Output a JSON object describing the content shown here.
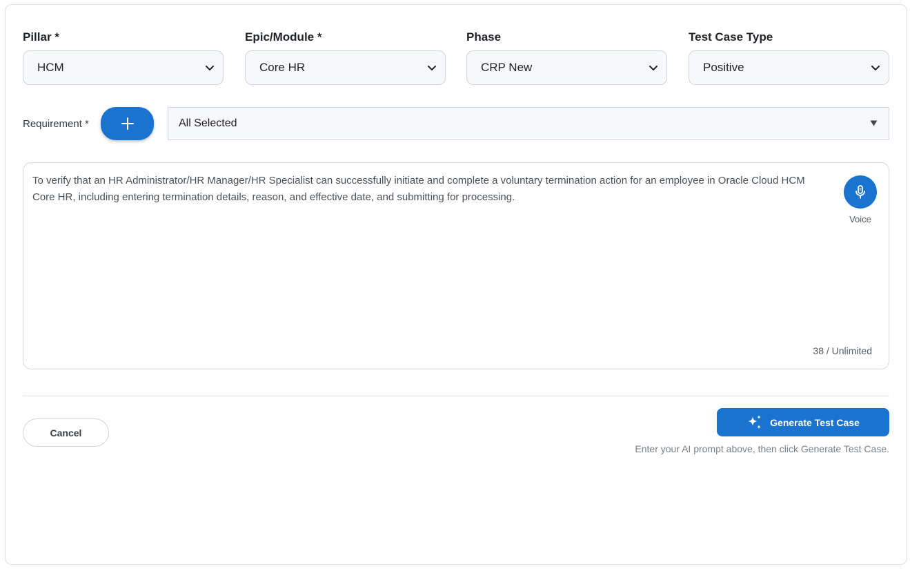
{
  "filters": {
    "pillar": {
      "label": "Pillar *",
      "value": "HCM"
    },
    "epic": {
      "label": "Epic/Module *",
      "value": "Core HR"
    },
    "phase": {
      "label": "Phase",
      "value": "CRP New"
    },
    "test_case_type": {
      "label": "Test Case Type",
      "value": "Positive"
    }
  },
  "requirement": {
    "label": "Requirement *",
    "value": "All Selected"
  },
  "prompt": {
    "text": "To verify that an HR Administrator/HR Manager/HR Specialist can successfully initiate and complete a voluntary termination action for an employee in Oracle Cloud HCM Core HR, including entering termination details, reason, and effective date, and submitting for processing.",
    "voice_label": "Voice",
    "counter": "38 / Unlimited"
  },
  "actions": {
    "cancel_label": "Cancel",
    "generate_label": "Generate Test Case",
    "hint": "Enter your AI prompt above, then click Generate Test Case."
  },
  "icons": {
    "add": "plus-icon",
    "voice": "microphone-icon",
    "generate": "sparkles-icon",
    "dropdown": "chevron-down-icon"
  },
  "colors": {
    "primary": "#1a73d1",
    "field_bg": "#f7f8fb",
    "border": "#cfd4da"
  }
}
